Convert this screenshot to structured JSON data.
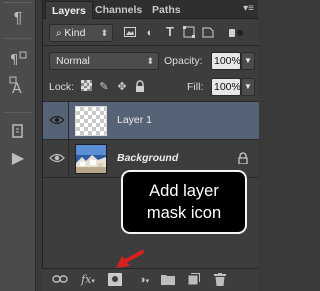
{
  "tabs": {
    "layers": "Layers",
    "channels": "Channels",
    "paths": "Paths"
  },
  "filter": {
    "kind_label": "Kind",
    "filter_icons": [
      "image-filter-icon",
      "adjustment-filter-icon",
      "type-filter-icon",
      "shape-filter-icon",
      "smart-object-filter-icon"
    ]
  },
  "blend": {
    "mode": "Normal",
    "opacity_label": "Opacity:",
    "opacity_value": "100%"
  },
  "lock": {
    "label": "Lock:",
    "fill_label": "Fill:",
    "fill_value": "100%"
  },
  "layers": [
    {
      "name": "Layer 1",
      "selected": true,
      "visible": true,
      "locked": false
    },
    {
      "name": "Background",
      "selected": false,
      "visible": true,
      "locked": true
    }
  ],
  "callout": {
    "line1": "Add layer",
    "line2": "mask icon"
  },
  "bottom_bar": {
    "fx_label": "fx",
    "icons": [
      "link-layers-icon",
      "layer-style-icon",
      "add-layer-mask-icon",
      "adjustment-layer-icon",
      "new-group-icon",
      "new-layer-icon",
      "trash-icon"
    ]
  },
  "colors": {
    "selected_layer": "#566275",
    "panel_bg": "#3d3d3d",
    "arrow": "#d91f1f"
  }
}
